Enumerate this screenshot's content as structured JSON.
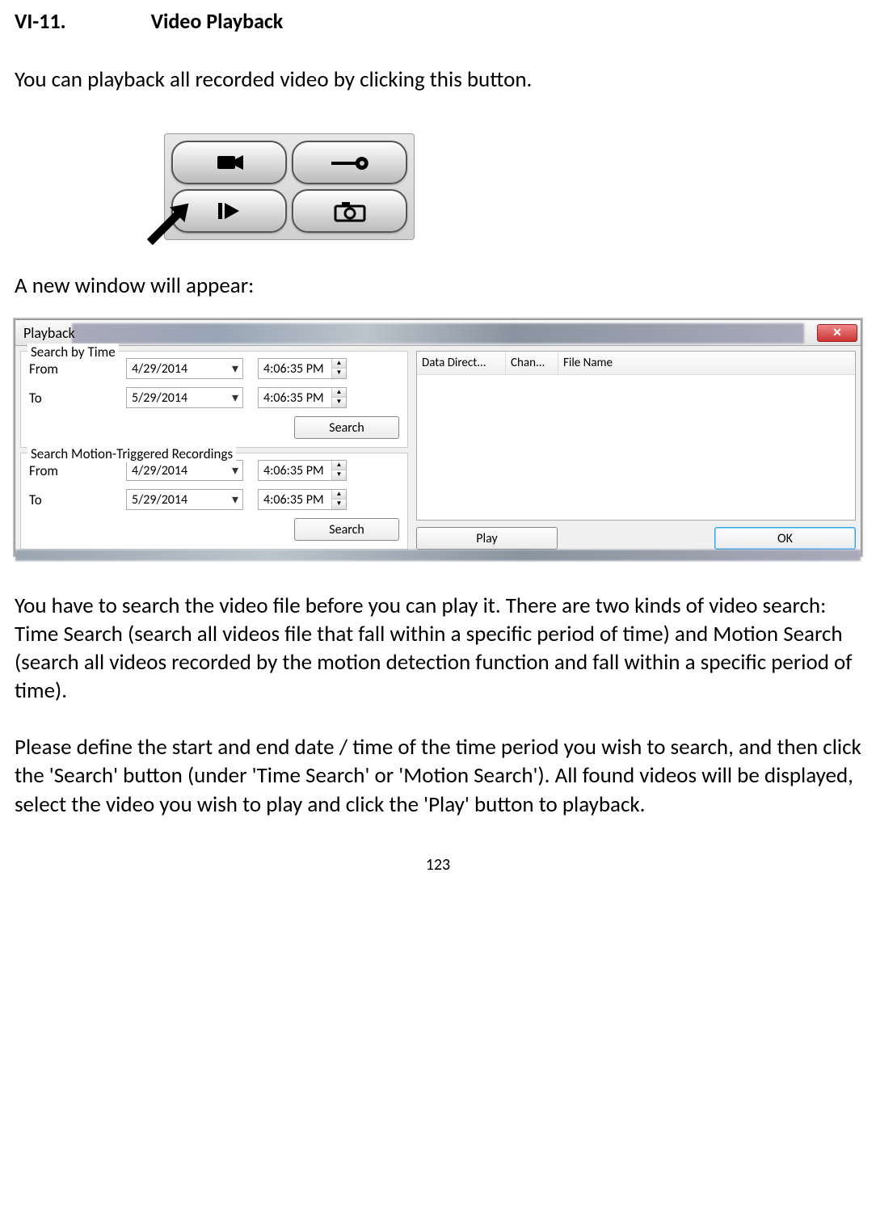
{
  "heading": {
    "number": "VI-11.",
    "title": "Video Playback"
  },
  "intro": "You can playback all recorded video by clicking this button.",
  "subhead": "A new window will appear:",
  "playback": {
    "title": "Playback",
    "close": "✕",
    "searchByTime": {
      "legend": "Search by Time",
      "from_label": "From",
      "from_date": "4/29/2014",
      "from_time": "4:06:35 PM",
      "to_label": "To",
      "to_date": "5/29/2014",
      "to_time": "4:06:35 PM",
      "search_btn": "Search"
    },
    "searchMotion": {
      "legend": "Search Motion-Triggered Recordings",
      "from_label": "From",
      "from_date": "4/29/2014",
      "from_time": "4:06:35 PM",
      "to_label": "To",
      "to_date": "5/29/2014",
      "to_time": "4:06:35 PM",
      "search_btn": "Search"
    },
    "list_headers": {
      "dir": "Data Direct...",
      "chan": "Chan...",
      "file": "File Name"
    },
    "play_btn": "Play",
    "ok_btn": "OK"
  },
  "para1": "You have to search the video file before you can play it. There are two kinds of video search: Time Search (search all videos file that fall within a specific period of time) and Motion Search (search all videos recorded by the motion detection function and fall within a specific period of time).",
  "para2": "Please define the start and end date / time of the time period you wish to search, and then click the 'Search' button (under 'Time Search' or 'Motion Search'). All found videos will be displayed, select the video you wish to play and click the 'Play' button to playback.",
  "pagenum": "123"
}
